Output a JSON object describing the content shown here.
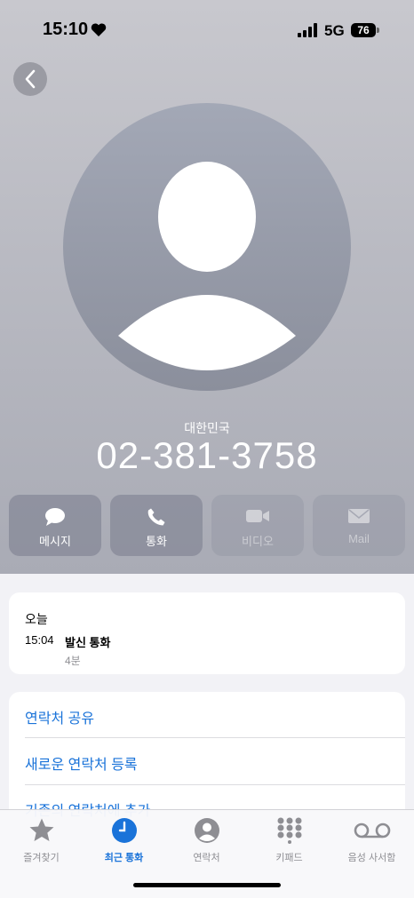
{
  "status_bar": {
    "time": "15:10",
    "network": "5G",
    "battery": "76"
  },
  "contact": {
    "country": "대한민국",
    "phone": "02-381-3758"
  },
  "actions": [
    {
      "label": "메시지",
      "icon": "message-bubble-icon",
      "enabled": true
    },
    {
      "label": "통화",
      "icon": "phone-icon",
      "enabled": true
    },
    {
      "label": "비디오",
      "icon": "video-camera-icon",
      "enabled": false
    },
    {
      "label": "Mail",
      "icon": "envelope-icon",
      "enabled": false
    }
  ],
  "recent": {
    "header": "오늘",
    "call": {
      "time": "15:04",
      "type": "발신 통화",
      "duration": "4분"
    }
  },
  "menu": {
    "share_contact": "연락처 공유",
    "create_contact": "새로운 연락처 등록",
    "add_existing": "기존의 연락처에 추가"
  },
  "tabbar": [
    {
      "label": "즐겨찾기",
      "icon": "star-icon",
      "active": false
    },
    {
      "label": "최근 통화",
      "icon": "clock-icon",
      "active": true
    },
    {
      "label": "연락처",
      "icon": "person-circle-icon",
      "active": false
    },
    {
      "label": "키패드",
      "icon": "keypad-icon",
      "active": false
    },
    {
      "label": "음성 사서함",
      "icon": "voicemail-icon",
      "active": false
    }
  ],
  "colors": {
    "accent": "#1a73d9",
    "hero_top": "#c8c8ce",
    "hero_bottom": "#a9abb5"
  }
}
